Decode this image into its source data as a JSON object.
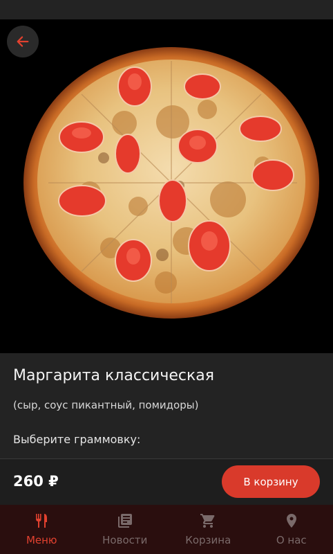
{
  "product": {
    "title": "Маргарита классическая",
    "description": "(сыр, соус пикантный, помидоры)",
    "weight_label": "Выберите граммовку:",
    "image": "pizza-margherita-photo"
  },
  "purchase": {
    "price": "260 ₽",
    "add_to_cart_label": "В корзину"
  },
  "back_button": {
    "icon": "arrow-left-icon"
  },
  "nav": [
    {
      "label": "Меню",
      "icon": "fork-knife-icon",
      "active": true
    },
    {
      "label": "Новости",
      "icon": "news-icon",
      "active": false
    },
    {
      "label": "Корзина",
      "icon": "cart-icon",
      "active": false
    },
    {
      "label": "О нас",
      "icon": "location-pin-icon",
      "active": false
    }
  ],
  "colors": {
    "accent": "#d93a2b",
    "nav_active": "#e2412f",
    "nav_inactive": "#7a6a6a",
    "background": "#1c1c1c",
    "nav_background": "#2a0e0e"
  }
}
